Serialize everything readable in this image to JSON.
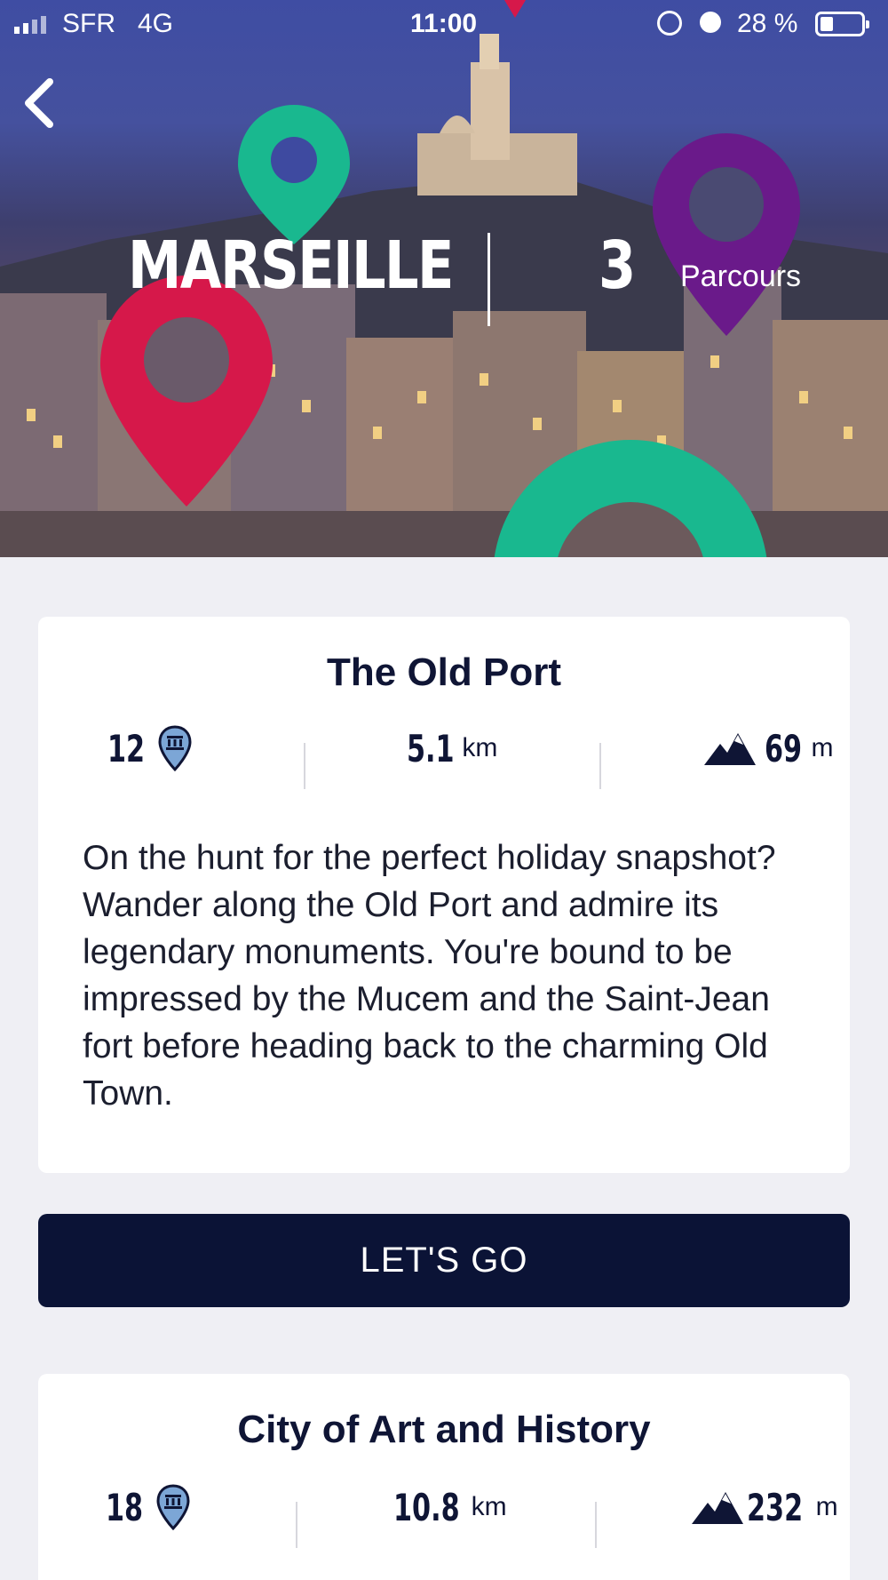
{
  "status_bar": {
    "carrier": "SFR",
    "network": "4G",
    "time": "11:00",
    "battery": "28 %"
  },
  "hero": {
    "city": "MARSEILLE",
    "route_count": "3",
    "routes_label": "Parcours",
    "pin_colors": [
      "#d6184a",
      "#19b88f",
      "#6a1a8a"
    ]
  },
  "routes": [
    {
      "title": "The Old Port",
      "poi_count": "12",
      "distance_value": "5.1",
      "distance_unit": "km",
      "elevation_value": "69",
      "elevation_unit": "m",
      "description": "On the hunt for the perfect holiday snapshot? Wander along the Old Port and admire its legendary monuments. You're bound to be impressed by the Mucem and the Saint-Jean fort before heading back to the charming Old Town.",
      "cta_label": "LET'S GO"
    },
    {
      "title": "City of Art and History",
      "poi_count": "18",
      "distance_value": "10.8",
      "distance_unit": "km",
      "elevation_value": "232",
      "elevation_unit": "m"
    }
  ],
  "colors": {
    "navy": "#0b1336",
    "background": "#efeff4"
  }
}
